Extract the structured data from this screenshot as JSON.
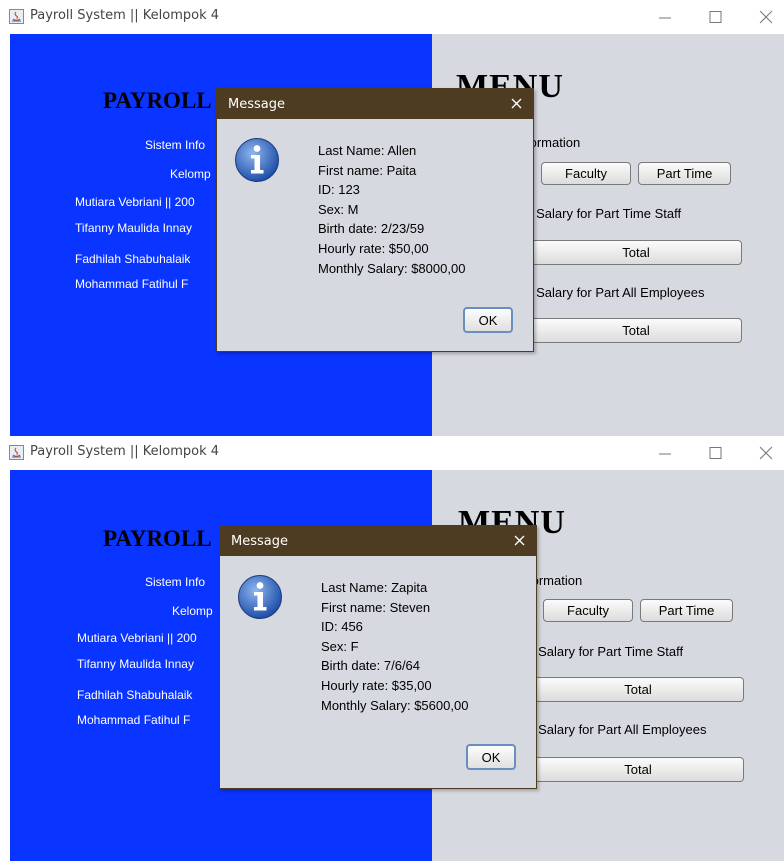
{
  "windows": [
    {
      "title": "Payroll System || Kelompok 4",
      "left_panel": {
        "heading": "PAYROLL",
        "line1": "Sistem Info",
        "line2": "Kelomp",
        "member1": "Mutiara Vebriani || 200",
        "member2": "Tifanny Maulida Innay",
        "member3": "Fadhilah Shabuhalaik",
        "member4": "Mohammad Fatihul F"
      },
      "right_panel": {
        "menu_title": "MENU",
        "info_label": "formation",
        "faculty_label": "Faculty",
        "part_time_label": "Part Time",
        "part_time_salary_label": "y Salary for Part Time Staff",
        "total1_label": "Total",
        "all_salary_label": "y Salary for Part All Employees",
        "total2_label": "Total"
      },
      "dialog": {
        "title": "Message",
        "icon": "info-icon",
        "lines": [
          "Last Name: Allen",
          "First name: Paita",
          "ID: 123",
          "Sex: M",
          "Birth date: 2/23/59",
          "Hourly rate: $50,00",
          "Monthly Salary: $8000,00"
        ],
        "ok_label": "OK"
      }
    },
    {
      "title": "Payroll System || Kelompok 4",
      "left_panel": {
        "heading": "PAYROLL",
        "line1": "Sistem Info",
        "line2": "Kelomp",
        "member1": "Mutiara Vebriani || 200",
        "member2": "Tifanny Maulida Innay",
        "member3": "Fadhilah Shabuhalaik",
        "member4": "Mohammad Fatihul F"
      },
      "right_panel": {
        "menu_title": "MENU",
        "info_label": "formation",
        "faculty_label": "Faculty",
        "part_time_label": "Part Time",
        "part_time_salary_label": "y Salary for Part Time Staff",
        "total1_label": "Total",
        "all_salary_label": "y Salary for Part All Employees",
        "total2_label": "Total"
      },
      "dialog": {
        "title": "Message",
        "icon": "info-icon",
        "lines": [
          "Last Name: Zapita",
          "First name: Steven",
          "ID: 456",
          "Sex: F",
          "Birth date: 7/6/64",
          "Hourly rate: $35,00",
          "Monthly Salary: $5600,00"
        ],
        "ok_label": "OK"
      }
    }
  ],
  "colors": {
    "left_panel": "#0a34ff",
    "right_panel": "#d6d9df",
    "dialog_titlebar": "#4d3b22",
    "dialog_body": "#d6d9df"
  }
}
